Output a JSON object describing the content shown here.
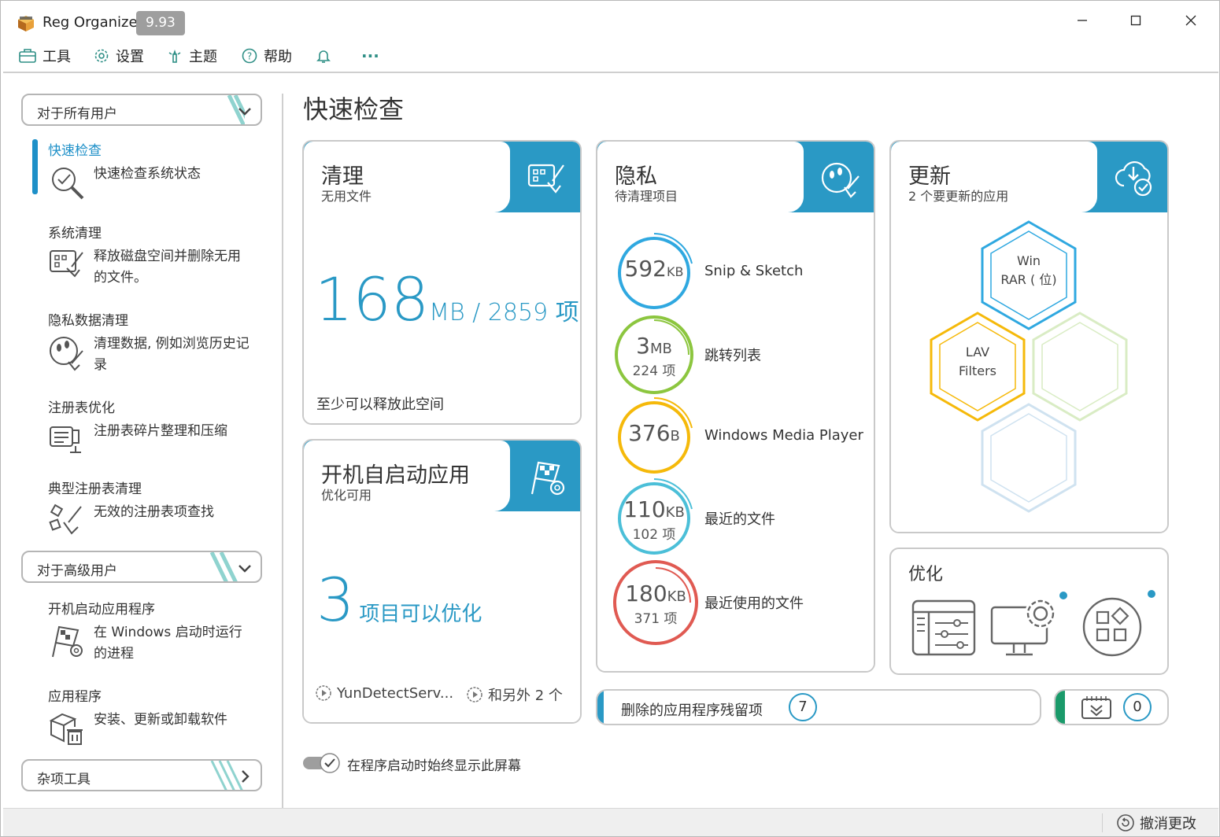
{
  "app": {
    "title": "Reg Organizer",
    "version": "9.93"
  },
  "window_controls": {
    "minimize": "—",
    "maximize": "☐",
    "close": "✕"
  },
  "menu": {
    "tools": "工具",
    "settings": "设置",
    "themes": "主题",
    "help": "帮助",
    "more": "···"
  },
  "sidebar": {
    "dropdown_all_users": "对于所有用户",
    "dropdown_advanced": "对于高级用户",
    "dropdown_misc": "杂项工具",
    "items": [
      {
        "title": "快速检查",
        "desc": "快速检查系统状态"
      },
      {
        "title": "系统清理",
        "desc": "释放磁盘空间并删除无用的文件。"
      },
      {
        "title": "隐私数据清理",
        "desc": "清理数据, 例如浏览历史记录"
      },
      {
        "title": "注册表优化",
        "desc": "注册表碎片整理和压缩"
      },
      {
        "title": "典型注册表清理",
        "desc": "无效的注册表项查找"
      },
      {
        "title": "开机启动应用程序",
        "desc": "在 Windows 启动时运行的进程"
      },
      {
        "title": "应用程序",
        "desc": "安装、更新或卸载软件"
      }
    ]
  },
  "main": {
    "title": "快速检查",
    "cleanup": {
      "title": "清理",
      "subtitle": "无用文件",
      "size_value": "168",
      "size_unit": "MB / 2859 项",
      "footer": "至少可以释放此空间"
    },
    "startup": {
      "title": "开机自启动应用",
      "subtitle": "优化可用",
      "count": "3",
      "count_label": "项目可以优化",
      "item1": "YunDetectServ...",
      "item2": "和另外 2 个"
    },
    "privacy": {
      "title": "隐私",
      "subtitle": "待清理项目",
      "items": [
        {
          "size": "592",
          "unit": "KB",
          "count": "",
          "label": "Snip & Sketch",
          "color": "#2fa8e0"
        },
        {
          "size": "3",
          "unit": "MB",
          "count": "224 项",
          "label": "跳转列表",
          "color": "#8cc63f"
        },
        {
          "size": "376",
          "unit": "B",
          "count": "",
          "label": "Windows Media Player",
          "color": "#f5b90a"
        },
        {
          "size": "110",
          "unit": "KB",
          "count": "102 项",
          "label": "最近的文件",
          "color": "#4bbfd8"
        },
        {
          "size": "180",
          "unit": "KB",
          "count": "371 项",
          "label": "最近使用的文件",
          "color": "#e05a52"
        }
      ]
    },
    "updates": {
      "title": "更新",
      "subtitle": "2 个要更新的应用",
      "apps": [
        {
          "line1": "Win",
          "line2": "RAR ( 位)"
        },
        {
          "line1": "LAV",
          "line2": "Filters"
        }
      ]
    },
    "optimize": {
      "title": "优化"
    },
    "leftovers": {
      "label": "删除的应用程序残留项",
      "count": "7"
    },
    "tasks": {
      "count": "0"
    },
    "show_on_start": "在程序启动时始终显示此屏幕"
  },
  "status": {
    "undo": "撤消更改"
  }
}
